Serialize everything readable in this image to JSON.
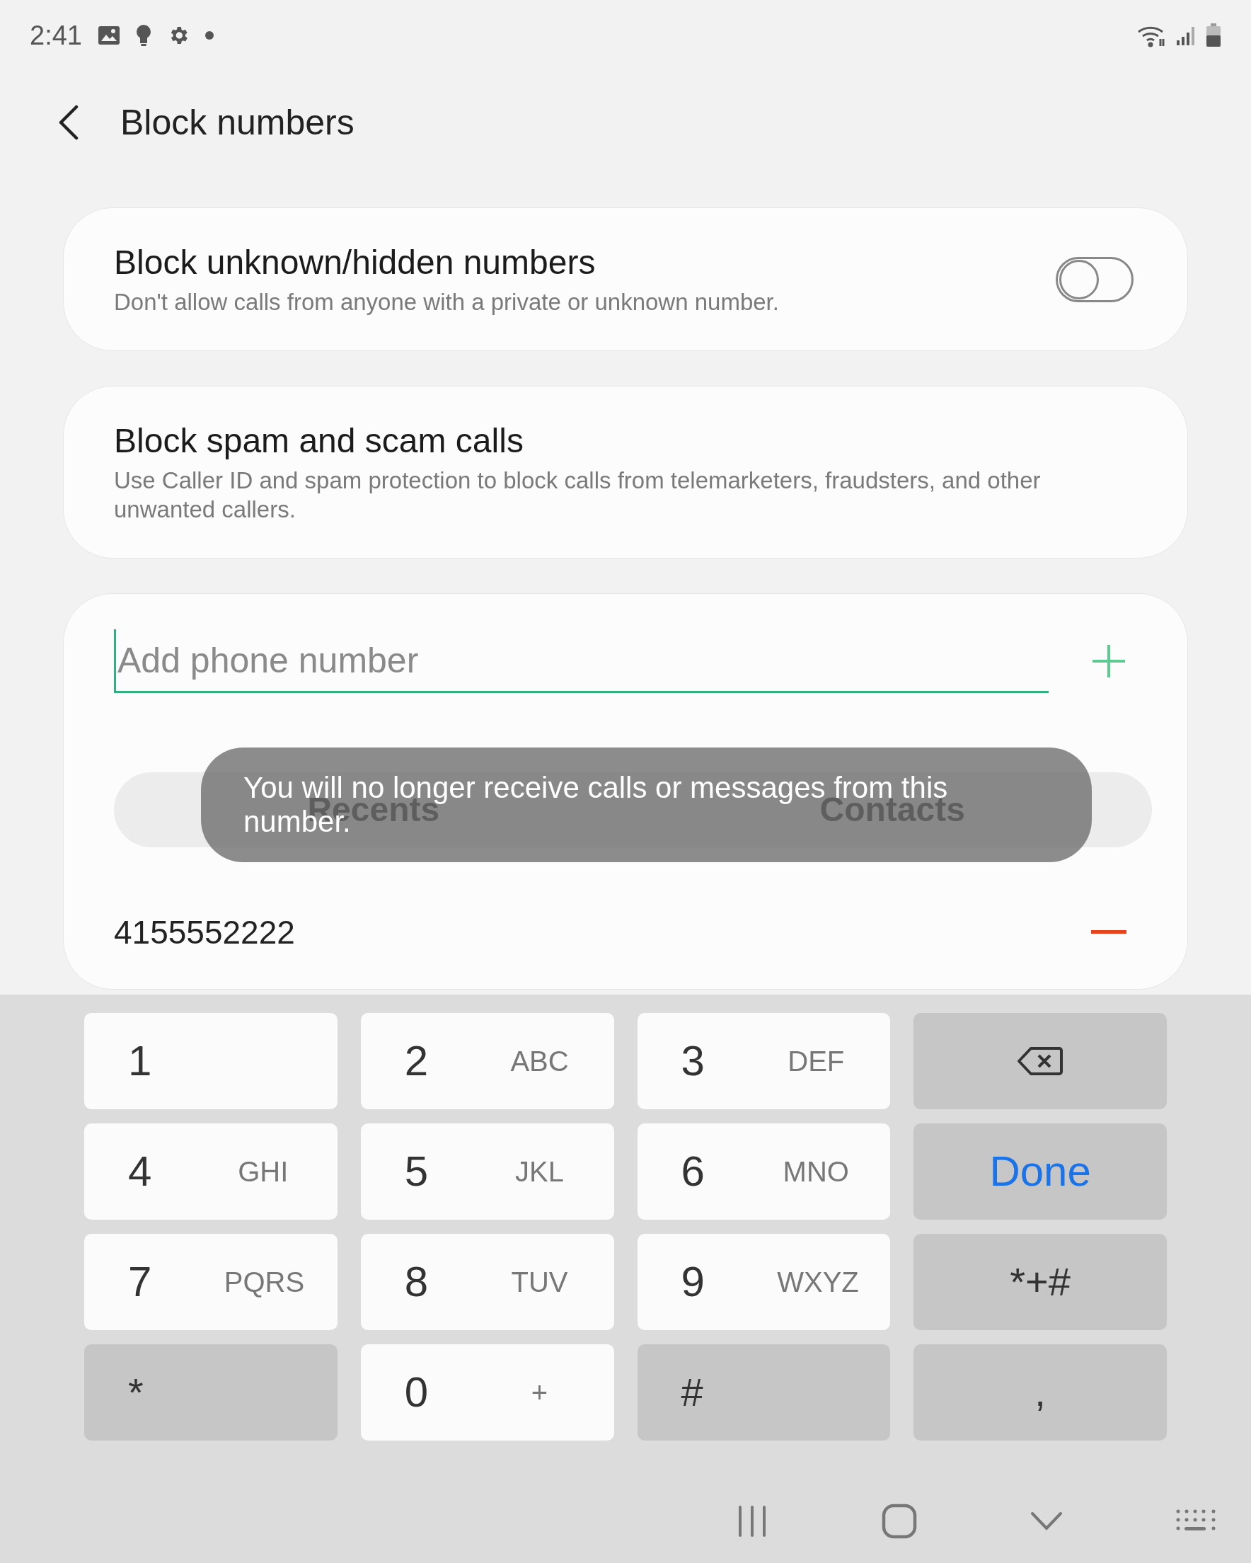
{
  "status_bar": {
    "time": "2:41"
  },
  "header": {
    "title": "Block numbers"
  },
  "settings": [
    {
      "title": "Block unknown/hidden numbers",
      "description": "Don't allow calls from anyone with a private or unknown number.",
      "kind": "switch",
      "on": false
    },
    {
      "title": "Block spam and scam calls",
      "description": "Use Caller ID and spam protection to block calls from telemarketers, fraudsters, and other unwanted callers.",
      "kind": "plain"
    }
  ],
  "add_number": {
    "placeholder": "Add phone number"
  },
  "sources": [
    {
      "label": "Recents"
    },
    {
      "label": "Contacts"
    }
  ],
  "toast": {
    "text": "You will no longer receive calls or messages from this number."
  },
  "blocked_numbers": [
    {
      "number": "4155552222"
    }
  ],
  "keypad": [
    {
      "kind": "digit",
      "label": "1"
    },
    {
      "kind": "digit",
      "label": "2",
      "letters": "ABC"
    },
    {
      "kind": "digit",
      "label": "3",
      "letters": "DEF"
    },
    {
      "kind": "backspace"
    },
    {
      "kind": "digit",
      "label": "4",
      "letters": "GHI"
    },
    {
      "kind": "digit",
      "label": "5",
      "letters": "JKL"
    },
    {
      "kind": "digit",
      "label": "6",
      "letters": "MNO"
    },
    {
      "kind": "done",
      "label": "Done"
    },
    {
      "kind": "digit",
      "label": "7",
      "letters": "PQRS"
    },
    {
      "kind": "digit",
      "label": "8",
      "letters": "TUV"
    },
    {
      "kind": "digit",
      "label": "9",
      "letters": "WXYZ"
    },
    {
      "kind": "symbol",
      "label": "*+#"
    },
    {
      "kind": "symbol",
      "label": "*"
    },
    {
      "kind": "digit",
      "label": "0",
      "letters": "+"
    },
    {
      "kind": "symbol",
      "label": "#"
    },
    {
      "kind": "symbol",
      "label": ","
    }
  ]
}
